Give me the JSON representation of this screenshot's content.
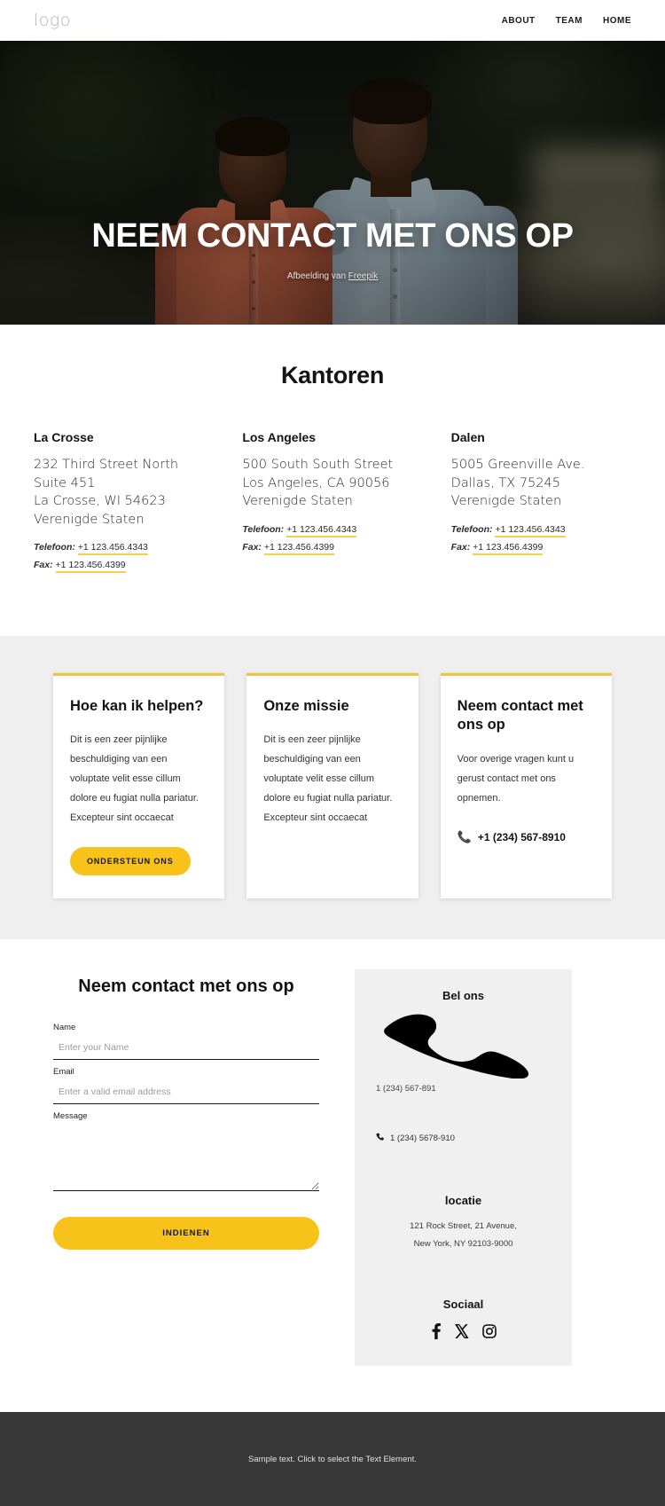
{
  "header": {
    "logo": "logo",
    "nav": [
      {
        "label": "ABOUT"
      },
      {
        "label": "TEAM"
      },
      {
        "label": "HOME"
      }
    ]
  },
  "hero": {
    "title": "NEEM CONTACT MET ONS OP",
    "caption_prefix": "Afbeelding van ",
    "caption_link": "Freepik"
  },
  "offices": {
    "title": "Kantoren",
    "items": [
      {
        "name": "La Crosse",
        "address": "232 Third Street North Suite 451\nLa Crosse, WI 54623\nVerenigde Staten",
        "phone_label": "Telefoon:",
        "phone": "+1 123.456.4343",
        "fax_label": "Fax:",
        "fax": "+1 123.456.4399"
      },
      {
        "name": "Los Angeles",
        "address": "500 South South Street\nLos Angeles, CA 90056\nVerenigde Staten",
        "phone_label": "Telefoon:",
        "phone": "+1 123.456.4343",
        "fax_label": "Fax:",
        "fax": "+1 123.456.4399"
      },
      {
        "name": "Dalen",
        "address": "5005 Greenville Ave.\nDallas, TX 75245\nVerenigde Staten",
        "phone_label": "Telefoon:",
        "phone": "+1 123.456.4343",
        "fax_label": "Fax:",
        "fax": "+1 123.456.4399"
      }
    ]
  },
  "cards": [
    {
      "title": "Hoe kan ik helpen?",
      "body": "Dit is een zeer pijnlijke beschuldiging van een voluptate velit esse cillum dolore eu fugiat nulla pariatur. Excepteur sint occaecat",
      "button": "ONDERSTEUN ONS"
    },
    {
      "title": "Onze missie",
      "body": "Dit is een zeer pijnlijke beschuldiging van een voluptate velit esse cillum dolore eu fugiat nulla pariatur. Excepteur sint occaecat"
    },
    {
      "title": "Neem contact met ons op",
      "body": "Voor overige vragen kunt u gerust contact met ons opnemen.",
      "phone": "+1 (234) 567-8910"
    }
  ],
  "contact_form": {
    "title": "Neem contact met ons op",
    "name_label": "Name",
    "name_placeholder": "Enter your Name",
    "name_value": "",
    "email_label": "Email",
    "email_placeholder": "Enter a valid email address",
    "email_value": "",
    "message_label": "Message",
    "message_placeholder": "",
    "message_value": "",
    "submit_label": "INDIENEN"
  },
  "info_panel": {
    "call_title": "Bel ons",
    "phone_primary": "1 (234) 567-891",
    "phone_secondary": "1 (234) 5678-910",
    "location_title": "locatie",
    "location_line1": "121 Rock Street, 21 Avenue,",
    "location_line2": "New York, NY 92103-9000",
    "social_title": "Sociaal",
    "social": [
      {
        "name": "facebook"
      },
      {
        "name": "x-twitter"
      },
      {
        "name": "instagram"
      }
    ]
  },
  "footer": {
    "text": "Sample text. Click to select the Text Element."
  },
  "colors": {
    "accent": "#f7c31a",
    "accent_underline": "#f2d24b",
    "strip_bg": "#efefef",
    "panel_bg": "#f0f0f0",
    "footer_bg": "#383838"
  }
}
